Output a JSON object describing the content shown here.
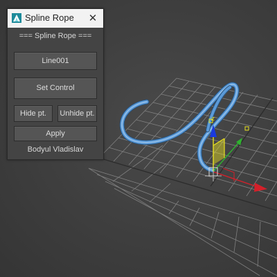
{
  "window": {
    "title": "Spline Rope",
    "close_glyph": "✕",
    "icon": "3ds-max-icon"
  },
  "panel": {
    "header": "=== Spline Rope ===",
    "line_button": "Line001",
    "set_control_button": "Set Control",
    "hide_button": "Hide pt.",
    "unhide_button": "Unhide pt.",
    "apply_button": "Apply",
    "author": "Bodyul Vladislav"
  },
  "viewport": {
    "gizmo_label": "z",
    "spline_color": "#4f8fcf",
    "grid_color": "#8a8a8a"
  },
  "colors": {
    "panel_bg": "#444444",
    "titlebar_bg": "#f2f2f2",
    "axis_x": "#d4202a",
    "axis_y": "#2fb12f",
    "axis_z": "#1a3adf",
    "plane_highlight": "#e8e020"
  }
}
